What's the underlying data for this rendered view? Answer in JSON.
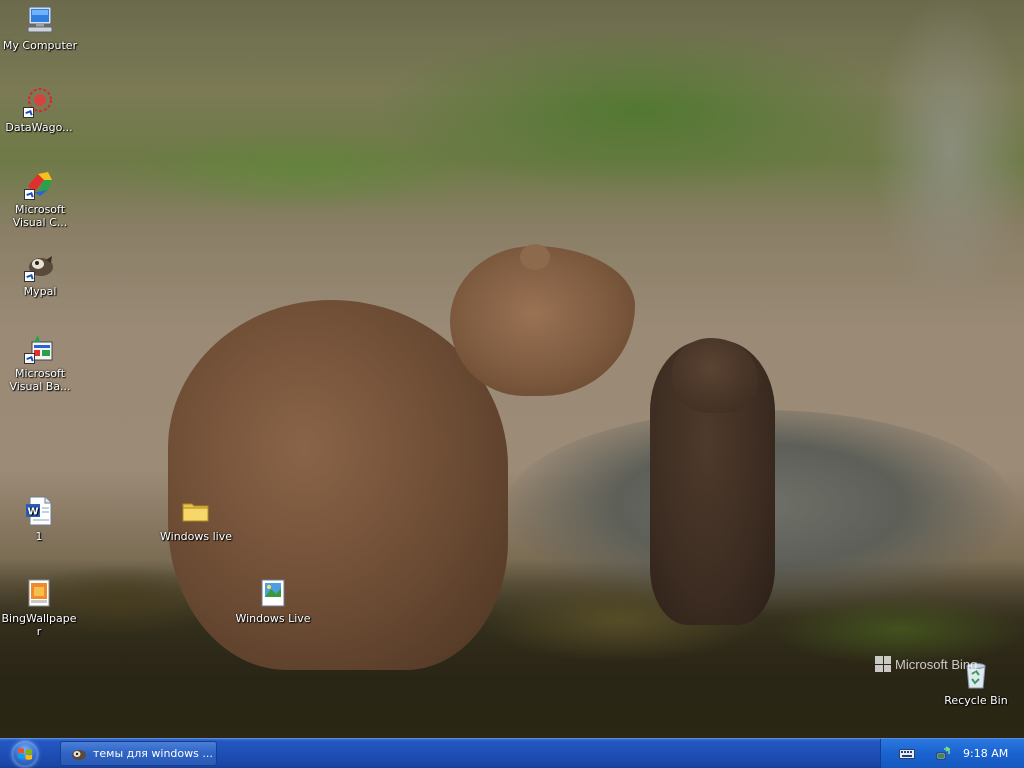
{
  "desktop": {
    "icons": [
      {
        "label": "My Computer",
        "icon": "my-computer-icon"
      },
      {
        "label": "DataWago...",
        "icon": "datawagon-icon"
      },
      {
        "label": "Microsoft Visual C...",
        "icon": "visual-c-icon"
      },
      {
        "label": "Mypal",
        "icon": "mypal-icon"
      },
      {
        "label": "Microsoft Visual Ba...",
        "icon": "visual-basic-icon"
      },
      {
        "label": "1",
        "icon": "word-document-icon"
      },
      {
        "label": "Windows live",
        "icon": "folder-icon"
      },
      {
        "label": "BingWallpaper",
        "icon": "bing-wallpaper-icon"
      },
      {
        "label": "Windows Live",
        "icon": "windows-live-icon"
      },
      {
        "label": "Recycle Bin",
        "icon": "recycle-bin-icon"
      }
    ],
    "watermark": "Microsoft Bing"
  },
  "taskbar": {
    "task_item_label": "темы для windows ...",
    "clock": "9:18 AM"
  },
  "colors": {
    "taskbar": "#1d4fb6",
    "tray": "#1a63d0"
  }
}
